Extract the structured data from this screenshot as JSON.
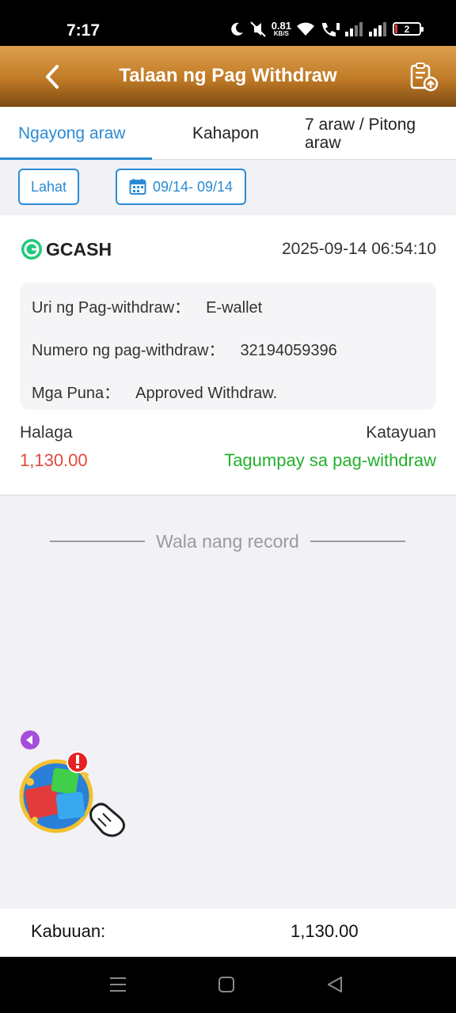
{
  "status_bar": {
    "time": "7:17",
    "net_speed_value": "0.81",
    "net_speed_unit": "KB/S",
    "battery_level": "2",
    "icons": [
      "moon-icon",
      "mute-icon",
      "wifi-icon",
      "wifi-call-icon",
      "signal-icon",
      "signal-icon",
      "battery-icon"
    ]
  },
  "header": {
    "title": "Talaan ng Pag Withdraw",
    "back_icon": "chevron-left-icon",
    "export_icon": "clipboard-upload-icon"
  },
  "tabs": [
    {
      "label": "Ngayong araw",
      "active": true
    },
    {
      "label": "Kahapon",
      "active": false
    },
    {
      "label": "7 araw / Pitong araw",
      "active": false
    }
  ],
  "filters": {
    "all_label": "Lahat",
    "date_range": "09/14- 09/14",
    "date_icon": "calendar-icon"
  },
  "record": {
    "provider": "GCASH",
    "datetime": "2025-09-14 06:54:10",
    "type_label": "Uri ng Pag-withdraw：",
    "type_value": "E-wallet",
    "number_label": "Numero ng pag-withdraw：",
    "number_value": "32194059396",
    "remarks_label": "Mga Puna：",
    "remarks_value": "Approved Withdraw.",
    "amount_label": "Halaga",
    "amount_value": "1,130.00",
    "status_label": "Katayuan",
    "status_value": "Tagumpay sa pag-withdraw"
  },
  "no_more_text": "Wala nang record",
  "total": {
    "label": "Kabuuan:",
    "value": "1,130.00"
  },
  "colors": {
    "accent": "#2a8bd4",
    "header_gold": "#c07a26",
    "amount_red": "#e04a3a",
    "success_green": "#23b02c"
  }
}
